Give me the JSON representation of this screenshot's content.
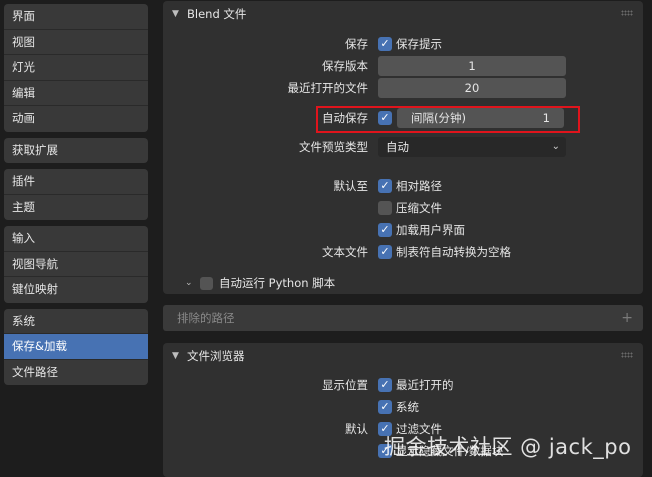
{
  "sidebar": {
    "groups": [
      [
        "界面",
        "视图",
        "灯光",
        "编辑",
        "动画"
      ],
      [
        "获取扩展"
      ],
      [
        "插件",
        "主题"
      ],
      [
        "输入",
        "视图导航",
        "键位映射"
      ],
      [
        "系统",
        "保存&加载",
        "文件路径"
      ]
    ],
    "active": "保存&加载"
  },
  "blend": {
    "title": "Blend 文件",
    "save_label": "保存",
    "save_prompt": "保存提示",
    "save_versions_label": "保存版本",
    "save_versions_value": "1",
    "recent_files_label": "最近打开的文件",
    "recent_files_value": "20",
    "autosave_label": "自动保存",
    "interval_label": "间隔(分钟)",
    "interval_value": "1",
    "preview_type_label": "文件预览类型",
    "preview_type_value": "自动",
    "default_to_label": "默认至",
    "relative_paths": "相对路径",
    "compress_file": "压缩文件",
    "load_ui": "加载用户界面",
    "text_files_label": "文本文件",
    "tabs_to_spaces": "制表符自动转换为空格",
    "autorun_python": "自动运行 Python 脚本",
    "excluded_paths": "排除的路径"
  },
  "file_browser": {
    "title": "文件浏览器",
    "display_label": "显示位置",
    "recent": "最近打开的",
    "system": "系统",
    "default_label": "默认",
    "filter_files": "过滤文件",
    "hidden_files": "显示隐藏文件/数据块"
  },
  "watermark": "掘金技术社区 @ jack_po",
  "colors": {
    "accent": "#4772b3",
    "highlight": "#e0141c"
  }
}
